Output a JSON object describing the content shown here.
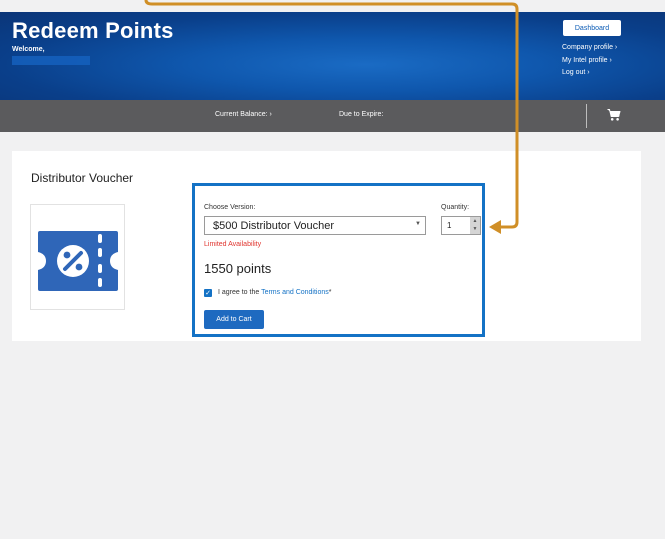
{
  "header": {
    "title": "Redeem Points",
    "welcome": "Welcome,",
    "dashboard_label": "Dashboard",
    "links": [
      "Company profile ›",
      "My Intel profile ›",
      "Log out ›"
    ]
  },
  "nav": {
    "balance_label": "Current Balance: ›",
    "expire_label": "Due to Expire:",
    "cart_icon": "shopping-cart-icon"
  },
  "product": {
    "title": "Distributor Voucher",
    "image_icon": "voucher-discount-icon",
    "version_label": "Choose Version:",
    "version_value": "$500 Distributor Voucher",
    "availability": "Limited Availability",
    "points": "1550 points",
    "quantity_label": "Quantity:",
    "quantity_value": "1",
    "agree_prefix": "I agree to the ",
    "agree_link": "Terms and Conditions",
    "agree_suffix": "*",
    "add_to_cart_label": "Add to Cart"
  },
  "colors": {
    "brand_blue": "#0f57ad",
    "highlight_border": "#1472c5",
    "annotation_arrow": "#d08f27",
    "alert_red": "#e0352f",
    "nav_gray": "#5b5b5d"
  }
}
